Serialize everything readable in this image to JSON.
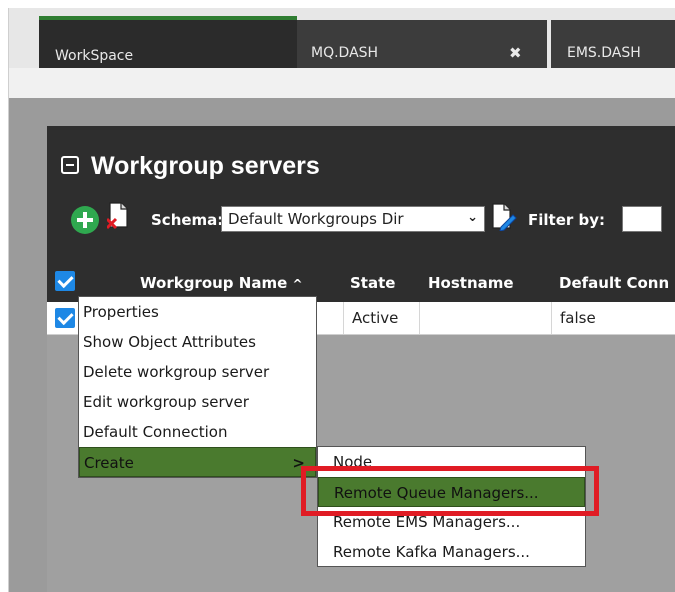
{
  "tabs": [
    {
      "label": "WorkSpace"
    },
    {
      "label": "MQ.DASH",
      "close": "✖"
    },
    {
      "label": "EMS.DASH"
    }
  ],
  "panel": {
    "title": "Workgroup servers"
  },
  "toolbar": {
    "schema_label": "Schema:",
    "schema_value": "Default Workgroups Dir",
    "filter_label": "Filter by:"
  },
  "table": {
    "columns": [
      "Workgroup Name",
      "State",
      "Hostname",
      "Default Conn"
    ],
    "sort_indicator": "^",
    "rows": [
      {
        "state": "Active",
        "hostname": "",
        "default_connection": "false"
      }
    ]
  },
  "context_menu": {
    "items": [
      {
        "label": "Properties"
      },
      {
        "label": "Show Object Attributes"
      },
      {
        "label": "Delete workgroup server"
      },
      {
        "label": "Edit workgroup server"
      },
      {
        "label": "Default Connection"
      },
      {
        "label": "Create",
        "arrow": ">"
      }
    ]
  },
  "submenu": {
    "items": [
      {
        "label": "Node"
      },
      {
        "label": "Remote Queue Managers..."
      },
      {
        "label": "Remote EMS Managers..."
      },
      {
        "label": "Remote Kafka Managers..."
      }
    ]
  },
  "colors": {
    "accent_green": "#2f7d32",
    "menu_highlight": "#4a7a2e",
    "checkbox_blue": "#1e88e5",
    "annotation_red": "#e01b24"
  }
}
